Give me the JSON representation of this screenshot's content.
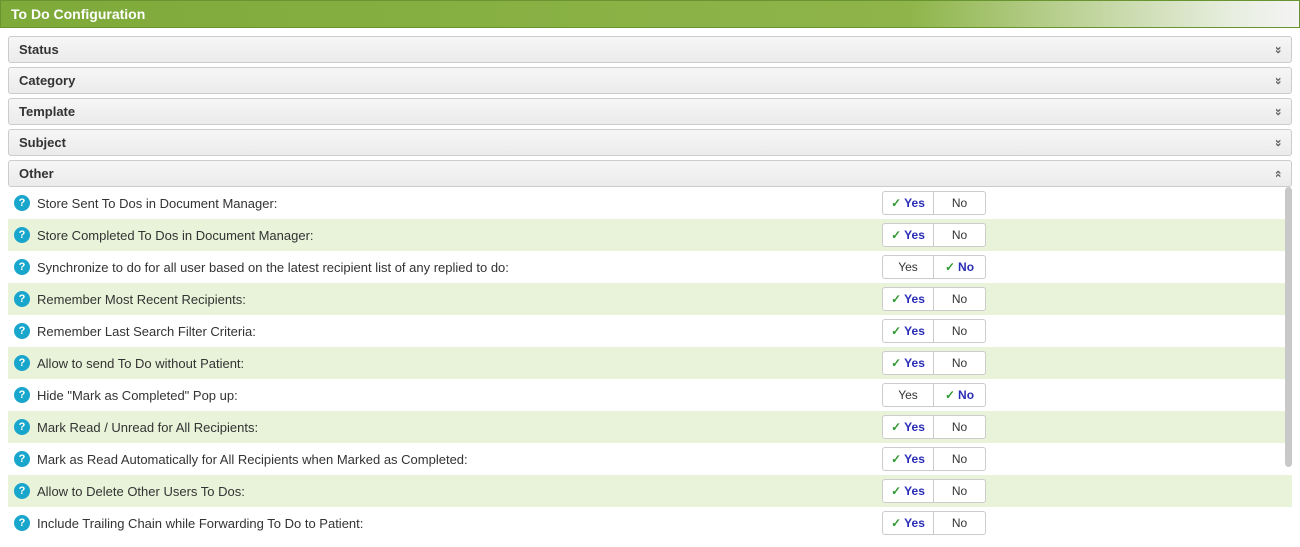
{
  "panel_title": "To Do Configuration",
  "collapsed_sections": [
    {
      "label": "Status"
    },
    {
      "label": "Category"
    },
    {
      "label": "Template"
    },
    {
      "label": "Subject"
    }
  ],
  "expanded_section": {
    "label": "Other"
  },
  "yes_label": "Yes",
  "no_label": "No",
  "rows": [
    {
      "label": "Store Sent To Dos in Document Manager:",
      "selected": "yes"
    },
    {
      "label": "Store Completed To Dos in Document Manager:",
      "selected": "yes"
    },
    {
      "label": "Synchronize to do for all user based on the latest recipient list of any replied to do:",
      "selected": "no"
    },
    {
      "label": "Remember Most Recent Recipients:",
      "selected": "yes"
    },
    {
      "label": "Remember Last Search Filter Criteria:",
      "selected": "yes"
    },
    {
      "label": "Allow to send To Do without Patient:",
      "selected": "yes"
    },
    {
      "label": "Hide \"Mark as Completed\" Pop up:",
      "selected": "no"
    },
    {
      "label": "Mark Read / Unread for All Recipients:",
      "selected": "yes"
    },
    {
      "label": "Mark as Read Automatically for All Recipients when Marked as Completed:",
      "selected": "yes"
    },
    {
      "label": "Allow to Delete Other Users To Dos:",
      "selected": "yes"
    },
    {
      "label": "Include Trailing Chain while Forwarding To Do to Patient:",
      "selected": "yes"
    }
  ]
}
